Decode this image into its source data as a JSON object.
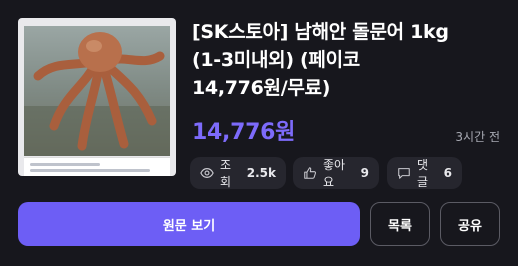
{
  "post": {
    "title_lines": [
      "[SK스토아] 남해안 돌문어 1kg",
      "(1-3미내외) (페이코",
      "14,776원/무료)"
    ],
    "price": "14,776원",
    "time": "3시간 전",
    "views_label": "조회",
    "views_value": "2.5k",
    "likes_label": "좋아요",
    "likes_value": "9",
    "comments_label": "댓글",
    "comments_value": "6",
    "accent_color": "#6d5ef5"
  },
  "actions": {
    "original_label": "원문 보기",
    "list_label": "목록",
    "share_label": "공유"
  },
  "icons": {
    "views": "eye-icon",
    "likes": "thumbs-up-icon",
    "comments": "chat-bubble-icon"
  }
}
